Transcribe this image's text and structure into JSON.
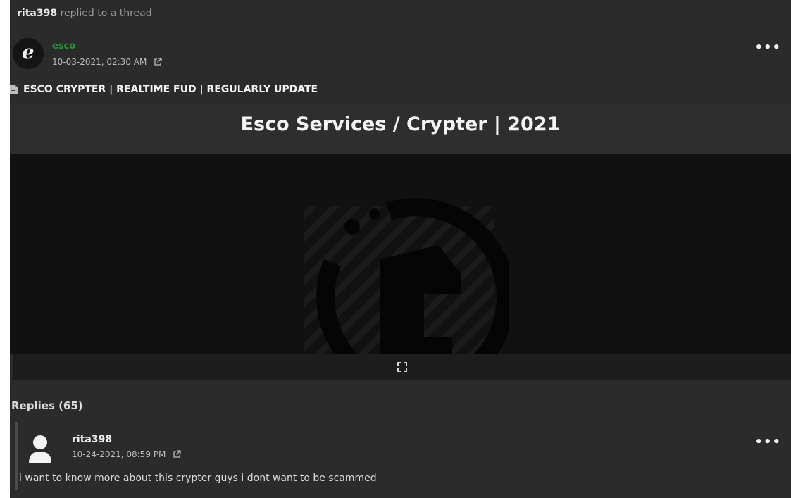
{
  "activity": {
    "user": "rita398",
    "action": "replied to a thread"
  },
  "post": {
    "avatar_letter": "e",
    "author": "esco",
    "timestamp": "10-03-2021, 02:30 AM",
    "thread_title": "ESCO CRYPTER | REALTIME FUD | REGULARLY UPDATE",
    "heading": "Esco Services / Crypter | 2021",
    "more_label": "•••"
  },
  "replies": {
    "title": "Replies (65)",
    "items": [
      {
        "author": "rita398",
        "timestamp": "10-24-2021, 08:59 PM",
        "text": "i want to know more about this crypter guys i dont want to be scammed",
        "more_label": "•••"
      }
    ]
  },
  "colors": {
    "background": "#2b2b2b",
    "author_green": "#1f9a3a",
    "video_bg": "#111111"
  },
  "icons": [
    "external-link-icon",
    "document-icon",
    "fullscreen-icon",
    "user-icon",
    "more-icon"
  ]
}
